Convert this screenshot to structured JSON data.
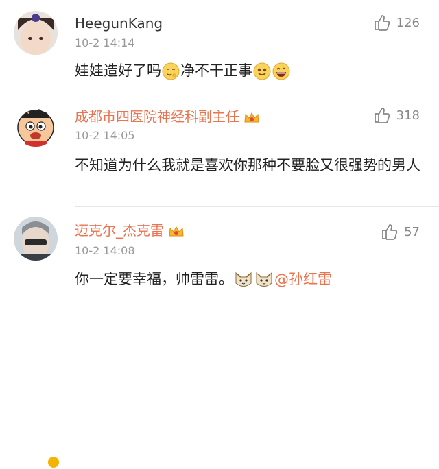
{
  "comments": [
    {
      "username": "HeegunKang",
      "time": "10-2 14:14",
      "likes": "126",
      "text_a": "娃娃造好了吗",
      "text_b": "净不干正事",
      "emoji": [
        "thinking-emoji",
        "smile-emoji",
        "grin-emoji"
      ]
    },
    {
      "username": "成都市四医院神经科副主任",
      "time": "10-2 14:05",
      "likes": "318",
      "text": "不知道为什么我就是喜欢你那种不要脸又很强势的男人"
    },
    {
      "username": "迈克尔_杰克雷",
      "time": "10-2 14:08",
      "likes": "57",
      "text": "你一定要幸福，帅雷雷。",
      "mention": "孙红雷"
    }
  ],
  "colors": {
    "vip_name": "#eb7350",
    "meta": "#999999"
  }
}
